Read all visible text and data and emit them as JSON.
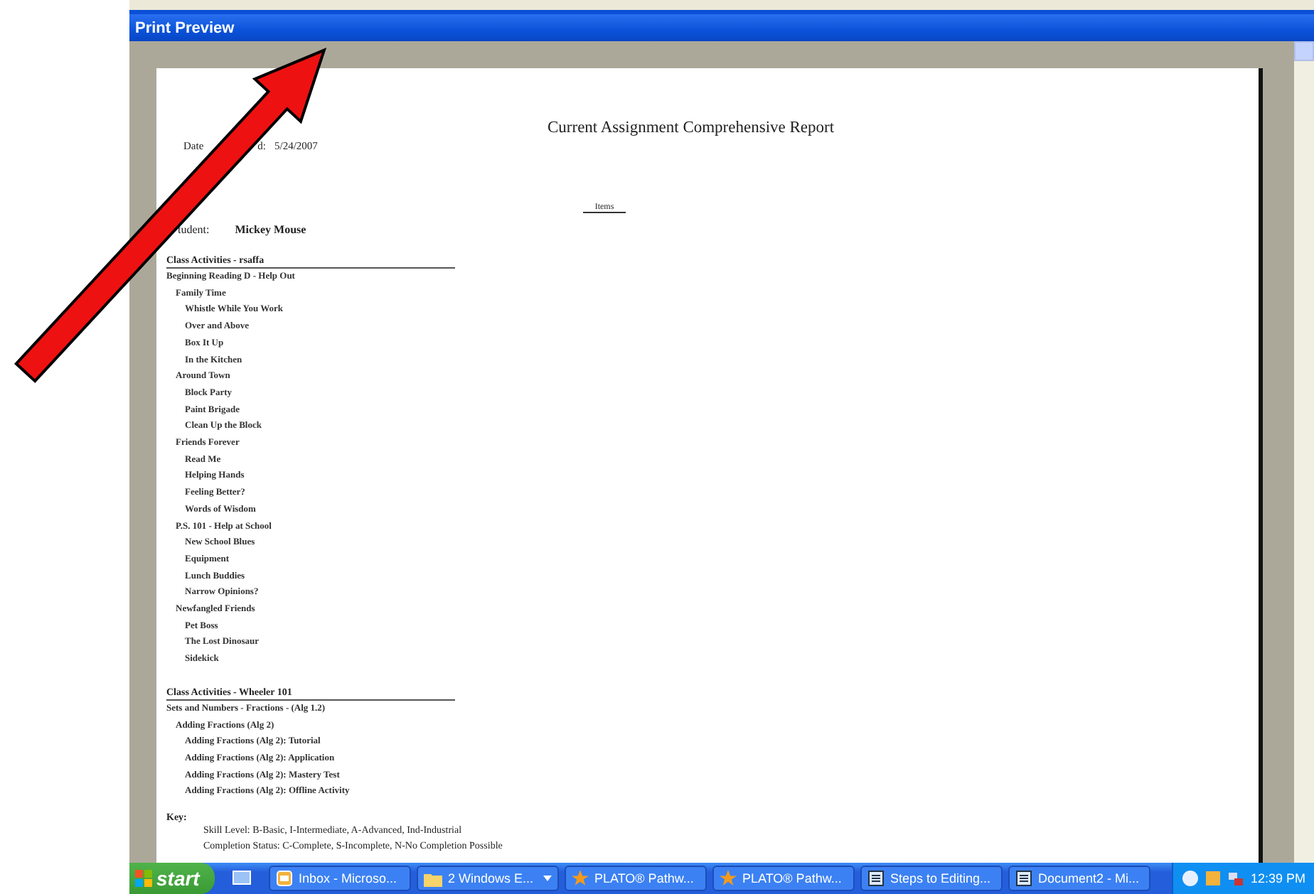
{
  "window": {
    "title": "Print Preview"
  },
  "report": {
    "title": "Current Assignment Comprehensive Report",
    "date_fragments": [
      "Date",
      "d:",
      "5/24/2007"
    ],
    "column_header": "Items",
    "student_label": "tudent:",
    "student_name": "Mickey Mouse",
    "sections": [
      {
        "title": "Class Activities - rsaffa",
        "items": [
          {
            "text": "Beginning Reading D - Help Out",
            "children": [
              {
                "text": "Family Time",
                "children": [
                  {
                    "text": "Whistle While You Work"
                  },
                  {
                    "text": "Over and Above"
                  },
                  {
                    "text": "Box It Up"
                  },
                  {
                    "text": "In the Kitchen"
                  }
                ]
              },
              {
                "text": "Around Town",
                "children": [
                  {
                    "text": "Block Party"
                  },
                  {
                    "text": "Paint Brigade"
                  },
                  {
                    "text": "Clean Up the Block"
                  }
                ]
              },
              {
                "text": "Friends Forever",
                "children": [
                  {
                    "text": "Read Me"
                  },
                  {
                    "text": "Helping Hands"
                  },
                  {
                    "text": "Feeling Better?"
                  },
                  {
                    "text": "Words of Wisdom"
                  }
                ]
              },
              {
                "text": "P.S. 101 - Help at School",
                "children": [
                  {
                    "text": "New School Blues"
                  },
                  {
                    "text": "Equipment"
                  },
                  {
                    "text": "Lunch Buddies"
                  },
                  {
                    "text": "Narrow Opinions?"
                  }
                ]
              },
              {
                "text": "Newfangled Friends",
                "children": [
                  {
                    "text": "Pet Boss"
                  },
                  {
                    "text": "The Lost Dinosaur"
                  },
                  {
                    "text": "Sidekick"
                  }
                ]
              }
            ]
          }
        ]
      },
      {
        "title": "Class Activities - Wheeler 101",
        "items": [
          {
            "text": "Sets and Numbers - Fractions - (Alg 1.2)",
            "children": [
              {
                "text": "Adding Fractions (Alg 2)",
                "children": [
                  {
                    "text": "Adding Fractions (Alg 2): Tutorial"
                  },
                  {
                    "text": "Adding Fractions (Alg 2): Application"
                  },
                  {
                    "text": "Adding Fractions (Alg 2): Mastery Test"
                  },
                  {
                    "text": "Adding Fractions (Alg 2): Offline Activity"
                  }
                ]
              }
            ]
          }
        ]
      }
    ],
    "key": {
      "title": "Key:",
      "lines": [
        "Skill Level:  B-Basic, I-Intermediate, A-Advanced, Ind-Industrial",
        "Completion Status:  C-Complete, S-Incomplete, N-No Completion Possible"
      ]
    }
  },
  "taskbar": {
    "start": "start",
    "buttons": [
      {
        "label": "Inbox - Microso...",
        "kind": "mail",
        "dropdown": false
      },
      {
        "label": "2 Windows E...",
        "kind": "folder",
        "dropdown": true
      },
      {
        "label": "PLATO® Pathw...",
        "kind": "star",
        "dropdown": false
      },
      {
        "label": "PLATO® Pathw...",
        "kind": "star",
        "dropdown": false
      },
      {
        "label": "Steps to Editing...",
        "kind": "doc",
        "dropdown": false
      },
      {
        "label": "Document2 - Mi...",
        "kind": "doc",
        "dropdown": false
      }
    ],
    "clock": "12:39 PM"
  }
}
